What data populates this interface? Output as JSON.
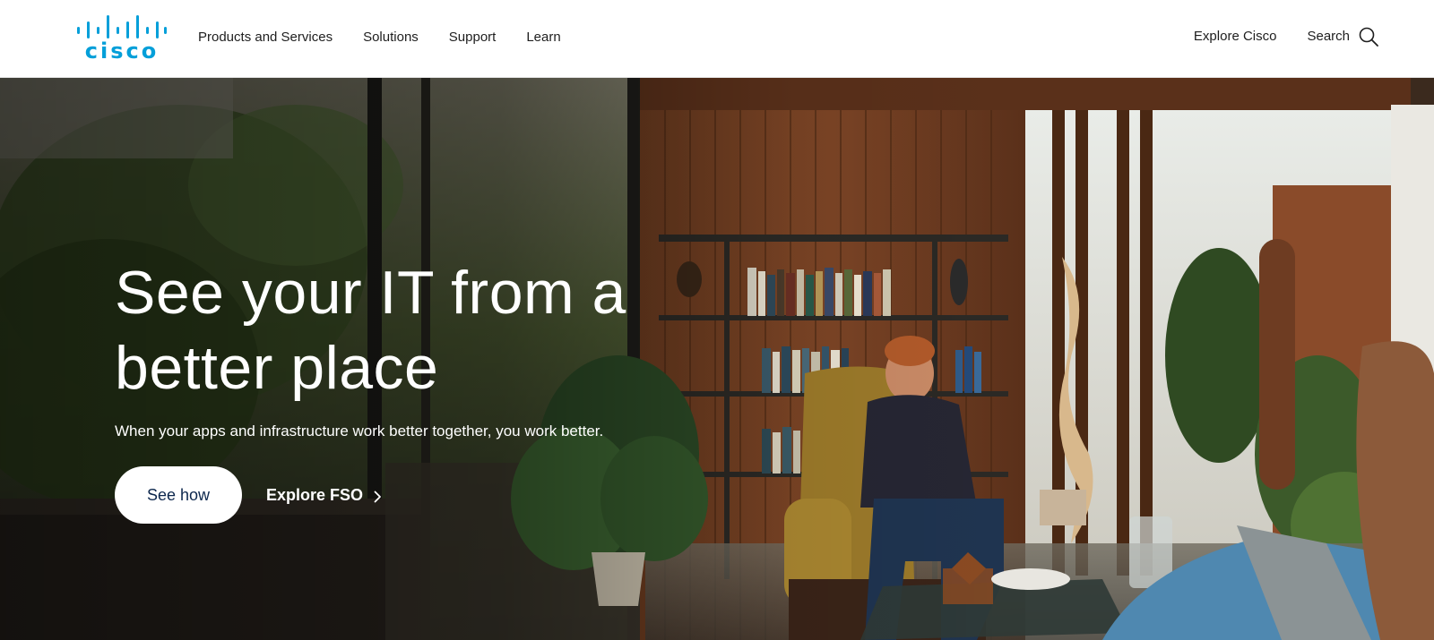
{
  "brand": {
    "logo_text": "cisco",
    "logo_icon": "cisco-bridge-logo",
    "color": "#049fd9"
  },
  "nav": {
    "items": [
      {
        "label": "Products and Services"
      },
      {
        "label": "Solutions"
      },
      {
        "label": "Support"
      },
      {
        "label": "Learn"
      }
    ],
    "explore_label": "Explore Cisco",
    "search_label": "Search",
    "search_icon": "search-icon"
  },
  "hero": {
    "title_line1": "See your IT from a",
    "title_line2": "better place",
    "subtitle": "When your apps and infrastructure work better together, you work better.",
    "primary_cta": "See how",
    "secondary_cta": "Explore FSO",
    "secondary_icon": "chevron-right-icon",
    "primary_cta_text_color": "#0d274d"
  }
}
